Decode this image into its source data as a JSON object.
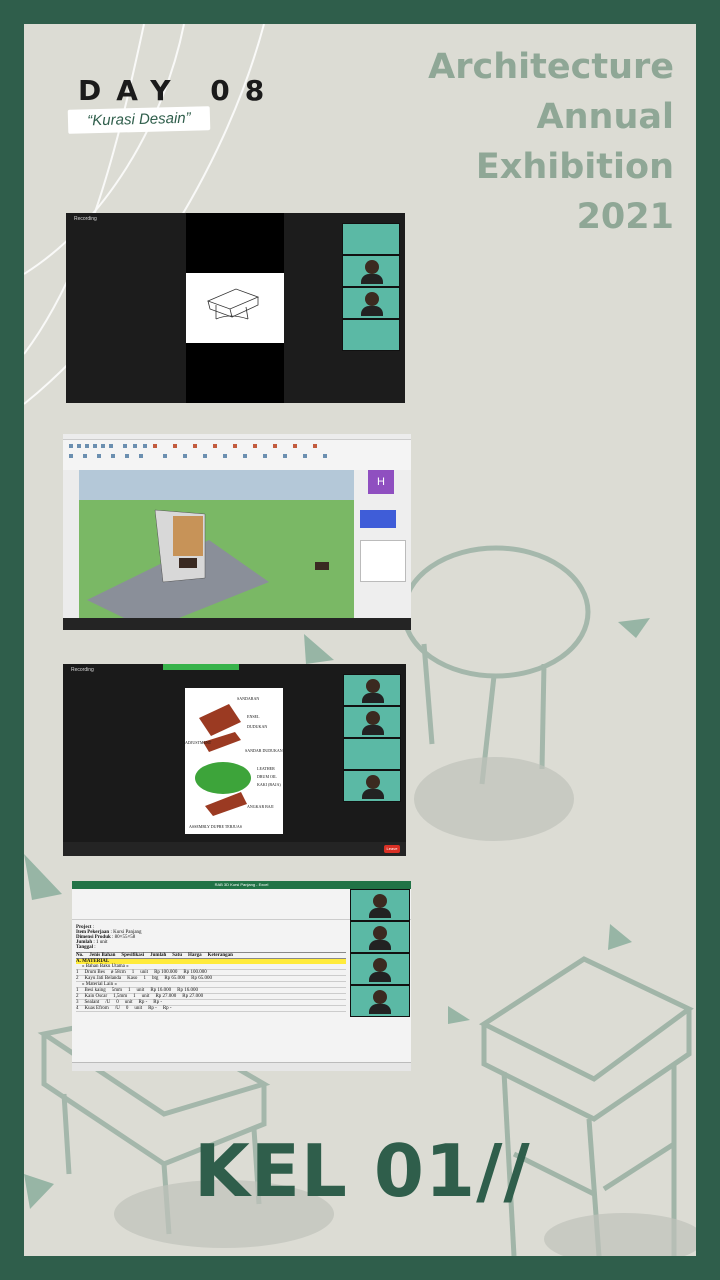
{
  "poster": {
    "day_label": "DAY 08",
    "subtitle": "“Kurasi Desain”",
    "event_title_lines": [
      "Architecture",
      "Annual",
      "Exhibition",
      "2021"
    ],
    "group_label": "KEL 01//"
  },
  "screenshots": {
    "meeting_1": {
      "recording_label": "Recording"
    },
    "sketchup": {
      "avatar_letter": "H"
    },
    "meeting_2": {
      "recording_label": "Recording",
      "leave_label": "Leave",
      "sheet_labels": [
        "SANDARAN",
        "ENSEL",
        "DUDUKAN",
        "ADJUSTMENT",
        "SANDAR DUDUKAN",
        "LEATHER",
        "DRUM OIL",
        "KAKI (BAJA)",
        "ANGKAR BAJI",
        "ASSEMBLY DUPRE TERJUAS"
      ]
    },
    "spreadsheet": {
      "window_title": "RAB 3D Kursi Panjang - Excel",
      "header_rows": [
        [
          "Project",
          ":",
          ""
        ],
        [
          "Item Pekerjaan",
          ":",
          "Kursi Panjang"
        ],
        [
          "Dimensi Produk",
          ":",
          "80×55×58"
        ],
        [
          "Jumlah",
          ":",
          "1 unit"
        ],
        [
          "Tanggal",
          ":",
          ""
        ]
      ],
      "columns": [
        "No.",
        "Jenis Bahan",
        "Spesifikasi",
        "Jumlah",
        "Satu",
        "Harga",
        "Keterangan"
      ],
      "section_label": "A. MATERIAL",
      "rows": [
        [
          "",
          "» Bahan Baku Utama «",
          "",
          "",
          "",
          "",
          ""
        ],
        [
          "1",
          "Drum Bes",
          "ø 58cm",
          "1",
          "unit",
          "Rp 100.000",
          "Rp 100.000"
        ],
        [
          "2",
          "Kayu Jati Belanda",
          "Kaso",
          "1",
          "btg",
          "Rp 65.000",
          "Rp 65.000"
        ],
        [
          "",
          "» Material Lain «",
          "",
          "",
          "",
          "",
          ""
        ],
        [
          "1",
          "Besi kaing",
          "5mm",
          "1",
          "unit",
          "Rp 16.000",
          "Rp 16.000"
        ],
        [
          "2",
          "Kain Oscar",
          "1,5mm",
          "1",
          "unit",
          "Rp 27.000",
          "Rp 27.000"
        ],
        [
          "3",
          "Sealant",
          "/U",
          "0",
          "unit",
          "Rp -",
          "Rp -"
        ],
        [
          "4",
          "Kuas Efrom",
          "/U",
          "0",
          "unit",
          "Rp -",
          "Rp -"
        ]
      ]
    }
  },
  "colors": {
    "frame_green": "#2f5e4b",
    "poster_bg": "#dcdcd4",
    "title_sage": "#8fa796",
    "participant_teal": "#5bb9a5"
  }
}
